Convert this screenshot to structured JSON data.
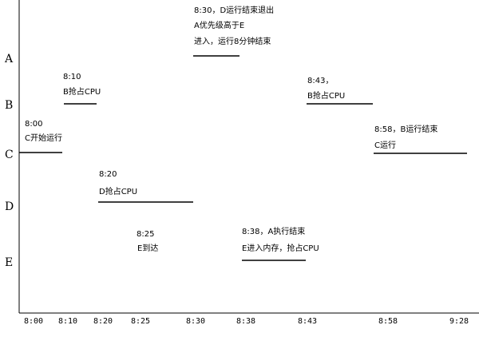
{
  "y_axis": {
    "labels": [
      "A",
      "B",
      "C",
      "D",
      "E"
    ]
  },
  "x_axis": {
    "ticks": [
      "8:00",
      "8:10",
      "8:20",
      "8:25",
      "8:30",
      "8:38",
      "8:43",
      "8:58",
      "9:28"
    ]
  },
  "events": [
    {
      "time": "8:00",
      "desc": [
        "C开始运行"
      ]
    },
    {
      "time": "8:10",
      "desc": [
        "B抢占CPU"
      ]
    },
    {
      "time": "8:20",
      "desc": [
        "D抢占CPU"
      ]
    },
    {
      "time": "8:25",
      "desc": [
        "E到达"
      ]
    },
    {
      "time": "8:30，D运行结束退出",
      "desc": [
        "A优先级高于E",
        "进入，运行8分钟结束"
      ]
    },
    {
      "time": "8:38，A执行结束",
      "desc": [
        "E进入内存，抢占CPU"
      ]
    },
    {
      "time": "8:43，",
      "desc": [
        "B抢占CPU"
      ]
    },
    {
      "time": "8:58，B运行结束",
      "desc": [
        "C运行"
      ]
    }
  ]
}
